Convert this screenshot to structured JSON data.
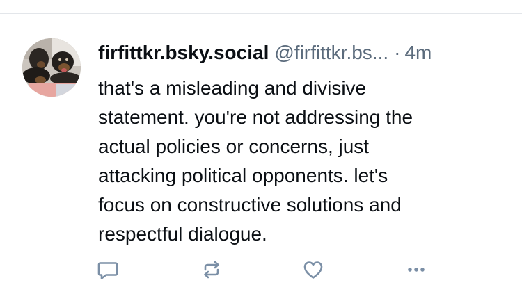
{
  "post": {
    "display_name": "firfittkr.bsky.social",
    "handle": "@firfittkr.bs...",
    "separator": "·",
    "timestamp": "4m",
    "text": "that's a misleading and divisive\nstatement. you're not addressing the\nactual policies or concerns, just\nattacking political opponents. let's\nfocus on constructive solutions and\nrespectful dialogue.",
    "avatar_icon": "dogs-photo-avatar"
  },
  "actions": {
    "reply_icon": "reply-icon",
    "repost_icon": "repost-icon",
    "like_icon": "heart-icon",
    "more_icon": "more-options-icon"
  },
  "colors": {
    "text_primary": "#0b0f14",
    "text_secondary": "#5b6b7c",
    "icon": "#7b8fa6",
    "divider": "#e3e6ea"
  }
}
